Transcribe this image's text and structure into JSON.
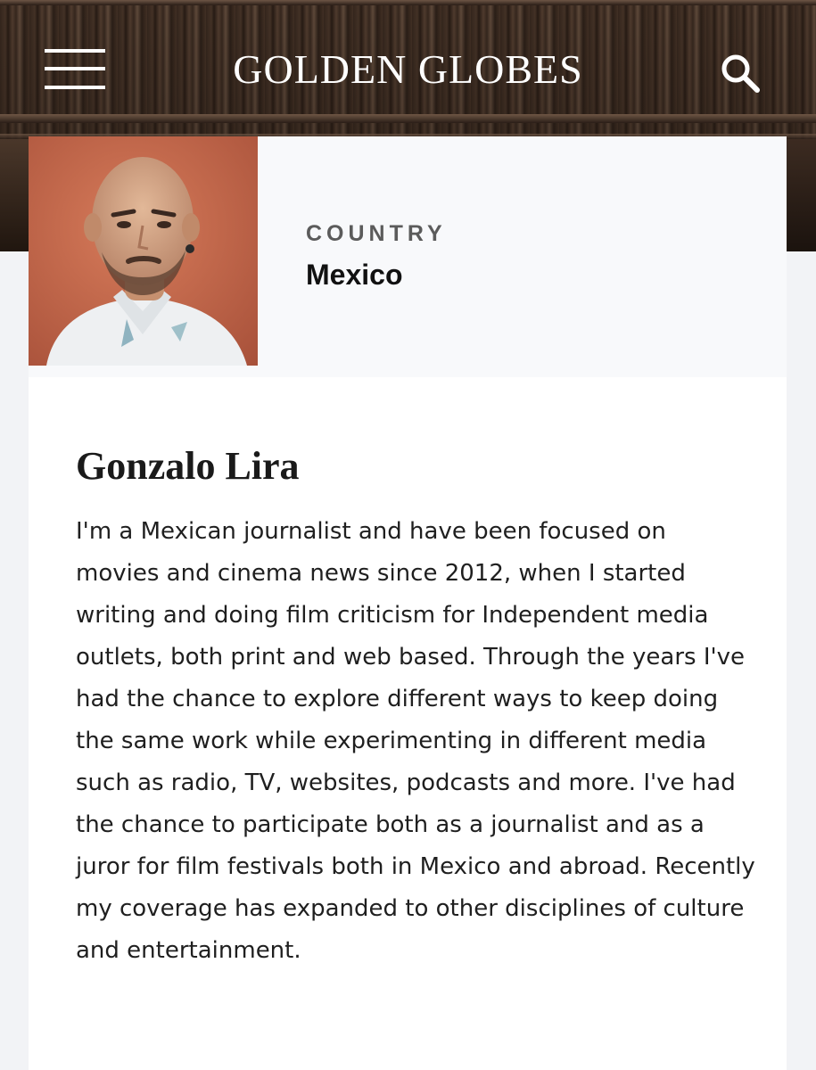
{
  "header": {
    "logo_text": "GOLDEN GLOBES",
    "menu_icon": "hamburger-menu-icon",
    "search_icon": "search-icon"
  },
  "profile": {
    "photo_alt": "Gonzalo Lira",
    "country_label": "COUNTRY",
    "country_value": "Mexico",
    "name": "Gonzalo Lira",
    "bio": "I'm a Mexican journalist and have been focused on movies and cinema news since 2012, when I started writing and doing film criticism for Independent media outlets, both print and web based. Through the years I've had the chance to explore different ways to keep doing the same work while experimenting in different media such as radio, TV, websites, podcasts and more. I've had the chance to participate both as a journalist and as a juror for film festivals both in Mexico and abroad. Recently my coverage has expanded to other disciplines of culture and entertainment."
  },
  "colors": {
    "header_text": "#ffffff",
    "photo_background": "#c8694a",
    "card_top_background": "#f8f9fb",
    "page_background": "#f2f3f6",
    "text_primary": "#1f1f1f",
    "label_gray": "#5b5b5b"
  }
}
